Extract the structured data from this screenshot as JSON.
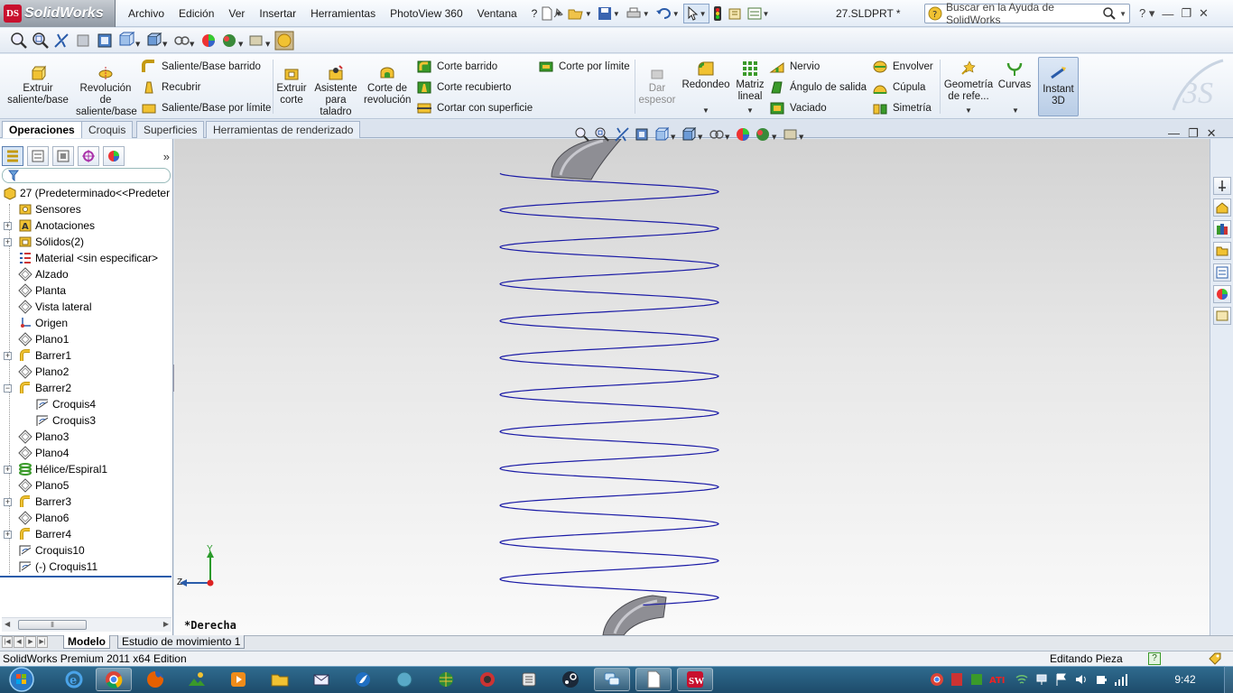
{
  "app": {
    "logo_text": "SolidWorks",
    "logo_mark": "DS",
    "document_title": "27.SLDPRT *"
  },
  "menu": {
    "items": [
      "Archivo",
      "Edición",
      "Ver",
      "Insertar",
      "Herramientas",
      "PhotoView 360",
      "Ventana",
      "?"
    ]
  },
  "help_search": {
    "placeholder": "Buscar en la Ayuda de SolidWorks"
  },
  "ribbon": {
    "extruir_saliente": "Extruir saliente/base",
    "revolucion_saliente": "Revolución de saliente/base",
    "saliente_barrido": "Saliente/Base barrido",
    "recubrir": "Recubrir",
    "saliente_limite": "Saliente/Base por límite",
    "extruir_corte": "Extruir corte",
    "asistente_taladro": "Asistente para taladro",
    "corte_revolucion": "Corte de revolución",
    "corte_barrido": "Corte barrido",
    "corte_recubierto": "Corte recubierto",
    "cortar_superficie": "Cortar con superficie",
    "corte_limite": "Corte por límite",
    "dar_espesor": "Dar espesor",
    "redondeo": "Redondeo",
    "matriz_lineal": "Matriz lineal",
    "nervio": "Nervio",
    "angulo_salida": "Ángulo de salida",
    "vaciado": "Vaciado",
    "envolver": "Envolver",
    "cupula": "Cúpula",
    "simetria": "Simetría",
    "geometria_ref": "Geometría de refe...",
    "curvas": "Curvas",
    "instant3d": "Instant 3D"
  },
  "command_tabs": [
    "Operaciones",
    "Croquis",
    "Superficies",
    "Herramientas de renderizado"
  ],
  "feature_tree": [
    {
      "label": "27  (Predeterminado<<Predeter",
      "icon": "part-icon",
      "level": 0,
      "expand": ""
    },
    {
      "label": "Sensores",
      "icon": "folder-sensor-icon",
      "level": 1,
      "expand": ""
    },
    {
      "label": "Anotaciones",
      "icon": "annotation-icon",
      "level": 1,
      "expand": "+"
    },
    {
      "label": "Sólidos(2)",
      "icon": "solid-bodies-icon",
      "level": 1,
      "expand": "+"
    },
    {
      "label": "Material <sin especificar>",
      "icon": "material-icon",
      "level": 1,
      "expand": ""
    },
    {
      "label": "Alzado",
      "icon": "plane-icon",
      "level": 1,
      "expand": ""
    },
    {
      "label": "Planta",
      "icon": "plane-icon",
      "level": 1,
      "expand": ""
    },
    {
      "label": "Vista lateral",
      "icon": "plane-icon",
      "level": 1,
      "expand": ""
    },
    {
      "label": "Origen",
      "icon": "origin-icon",
      "level": 1,
      "expand": ""
    },
    {
      "label": "Plano1",
      "icon": "plane-icon",
      "level": 1,
      "expand": ""
    },
    {
      "label": "Barrer1",
      "icon": "sweep-icon",
      "level": 1,
      "expand": "+"
    },
    {
      "label": "Plano2",
      "icon": "plane-icon",
      "level": 1,
      "expand": ""
    },
    {
      "label": "Barrer2",
      "icon": "sweep-icon",
      "level": 1,
      "expand": "−"
    },
    {
      "label": "Croquis4",
      "icon": "sketch-icon",
      "level": 2,
      "expand": ""
    },
    {
      "label": "Croquis3",
      "icon": "sketch-icon",
      "level": 2,
      "expand": ""
    },
    {
      "label": "Plano3",
      "icon": "plane-icon",
      "level": 1,
      "expand": ""
    },
    {
      "label": "Plano4",
      "icon": "plane-icon",
      "level": 1,
      "expand": ""
    },
    {
      "label": "Hélice/Espiral1",
      "icon": "helix-icon",
      "level": 1,
      "expand": "+"
    },
    {
      "label": "Plano5",
      "icon": "plane-icon",
      "level": 1,
      "expand": ""
    },
    {
      "label": "Barrer3",
      "icon": "sweep-icon",
      "level": 1,
      "expand": "+"
    },
    {
      "label": "Plano6",
      "icon": "plane-icon",
      "level": 1,
      "expand": ""
    },
    {
      "label": "Barrer4",
      "icon": "sweep-icon",
      "level": 1,
      "expand": "+"
    },
    {
      "label": "Croquis10",
      "icon": "sketch-icon",
      "level": 1,
      "expand": ""
    },
    {
      "label": "(-) Croquis11",
      "icon": "sketch-icon",
      "level": 1,
      "expand": ""
    }
  ],
  "viewport": {
    "view_name": "*Derecha",
    "axis_y": "Y",
    "axis_z": "Z",
    "helix_color": "#1a1aa6"
  },
  "bottom_tabs": [
    "Modelo",
    "Estudio de movimiento 1"
  ],
  "status": {
    "edition": "SolidWorks Premium 2011 x64 Edition",
    "mode": "Editando Pieza"
  },
  "taskbar": {
    "clock": "9:42"
  },
  "colors": {
    "accent": "#2f6b8f",
    "logo_red": "#c8102e",
    "ribbon_icon_yellow": "#e8c21a",
    "ribbon_icon_green": "#3a9a2a"
  }
}
